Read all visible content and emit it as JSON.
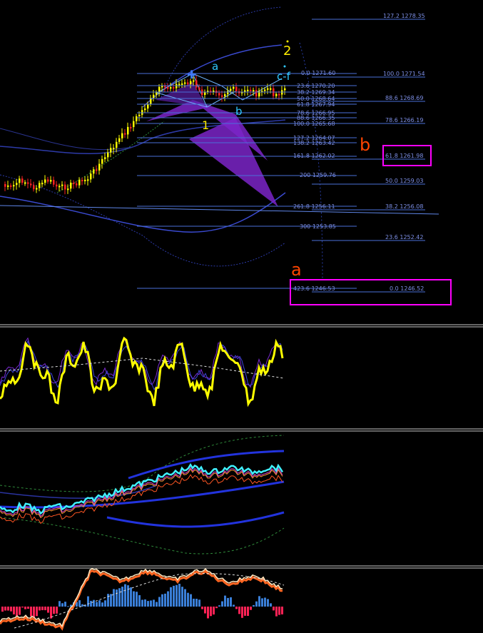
{
  "colors": {
    "background": "#000000",
    "fib_line": "#4a6fd8",
    "fib_text": "#7d8fe6",
    "bull_candle": "#ffff00",
    "bear_candle": "#ff2222",
    "highlight_box": "#ff00ff",
    "wave_orange": "#ff4400",
    "wave_yellow": "#ffee00",
    "wave_cyan": "#30c8ff",
    "triangle": "#7b25c8",
    "separator": "#c8c8c8",
    "osc_yellow": "#ffff00",
    "osc_cyan": "#40f0ff",
    "macd_blue": "#3a7fd8",
    "macd_red": "#ff2255",
    "ma_blue": "#2233dd"
  },
  "waves": {
    "big_a": "a",
    "big_b": "b",
    "label_2": "2",
    "label_1": "1",
    "small_a": "a",
    "small_b": "b",
    "cf": "c-f"
  },
  "fib_left": [
    {
      "label": "0.0 1271.60"
    },
    {
      "label": "23.6 1270.20"
    },
    {
      "label": "38.2 1269.34"
    },
    {
      "label": "50.0 1268.64"
    },
    {
      "label": "61.8 1267.94"
    },
    {
      "label": "78.6 1266.95"
    },
    {
      "label": "88.6 1266.35"
    },
    {
      "label": "100.0 1265.68"
    },
    {
      "label": "127.2 1264.07"
    },
    {
      "label": "138.2 1263.42"
    },
    {
      "label": "161.8 1262.02"
    },
    {
      "label": "200 1259.76"
    },
    {
      "label": "261.8 1256.11"
    },
    {
      "label": "300 1253.85"
    },
    {
      "label": "423.6 1246.53"
    }
  ],
  "fib_right": [
    {
      "label": "127.2 1278.35"
    },
    {
      "label": "100.0 1271.54"
    },
    {
      "label": "88.6 1268.69"
    },
    {
      "label": "78.6 1266.19"
    },
    {
      "label": "61.8 1261.98"
    },
    {
      "label": "50.0 1259.03"
    },
    {
      "label": "38.2 1256.08"
    },
    {
      "label": "23.6 1252.42"
    },
    {
      "label": "0.0 1246.52"
    }
  ]
}
